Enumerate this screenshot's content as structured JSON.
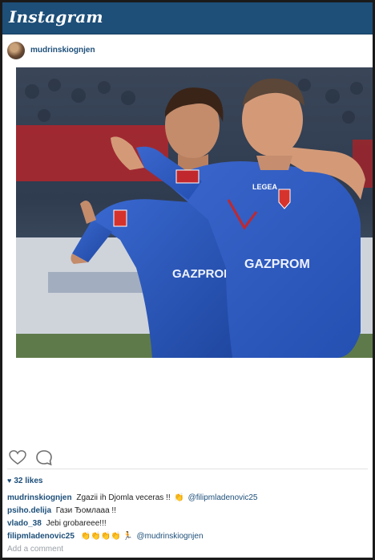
{
  "app": {
    "title": "Instagram"
  },
  "post": {
    "username": "mudrinskiognjen",
    "likes": "32 likes",
    "photo_text": {
      "badge_brand": "LEGEA",
      "sponsor": "GAZPROM"
    }
  },
  "comments": [
    {
      "user": "mudrinskiognjen",
      "text": "Zgazii  ih Djomla veceras !!",
      "emoji": "👏",
      "mention": "@filipmladenovic25"
    },
    {
      "user": "psiho.delija",
      "text": "Гази Ђомлааа !!",
      "emoji": "",
      "mention": ""
    },
    {
      "user": "vlado_38",
      "text": "Jebi grobareee!!!",
      "emoji": "",
      "mention": ""
    },
    {
      "user": "filipmladenovic25",
      "text": "",
      "emoji": "👏👏👏👏 🏃",
      "mention": "@mudrinskiognjen"
    }
  ],
  "add_comment_placeholder": "Add a comment",
  "colors": {
    "header": "#1d4f79",
    "link": "#1d4f79",
    "jersey": "#2c55b8"
  },
  "icons": [
    "heart-outline-icon",
    "comment-bubble-icon",
    "small-heart-icon"
  ]
}
